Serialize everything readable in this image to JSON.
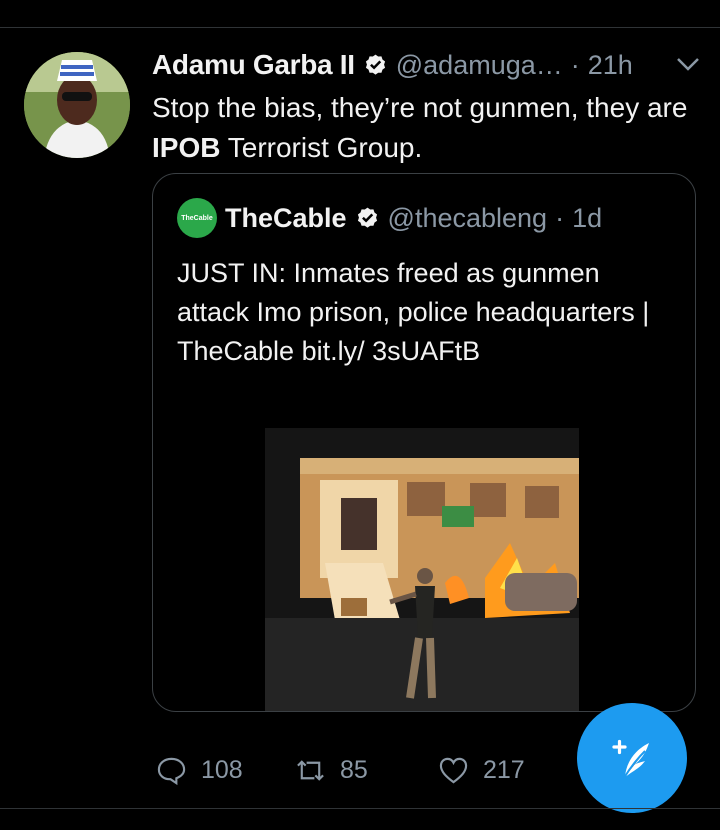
{
  "tweet": {
    "author_name": "Adamu Garba II",
    "handle": "@adamuga…",
    "separator": "·",
    "time": "21h",
    "text_before": "Stop the bias, they’re not gunmen, they are ",
    "text_emphasis": "IPOB",
    "text_after": " Terrorist Group."
  },
  "quoted_tweet": {
    "logo_text": "TheCable",
    "author_name": "TheCable",
    "handle": "@thecableng",
    "separator": "·",
    "time": "1d",
    "text": "JUST IN: Inmates freed as gunmen attack Imo prison, police headquarters | TheCable bit.ly/ 3sUAFtB"
  },
  "actions": {
    "reply_count": "108",
    "retweet_count": "85",
    "like_count": "217"
  },
  "colors": {
    "background": "#000000",
    "accent": "#1d9bf0",
    "muted": "#8b98a5",
    "brand_green": "#2ba84a"
  },
  "icons": [
    "verified-badge-icon",
    "chevron-down-icon",
    "reply-icon",
    "retweet-icon",
    "like-icon",
    "compose-icon"
  ]
}
